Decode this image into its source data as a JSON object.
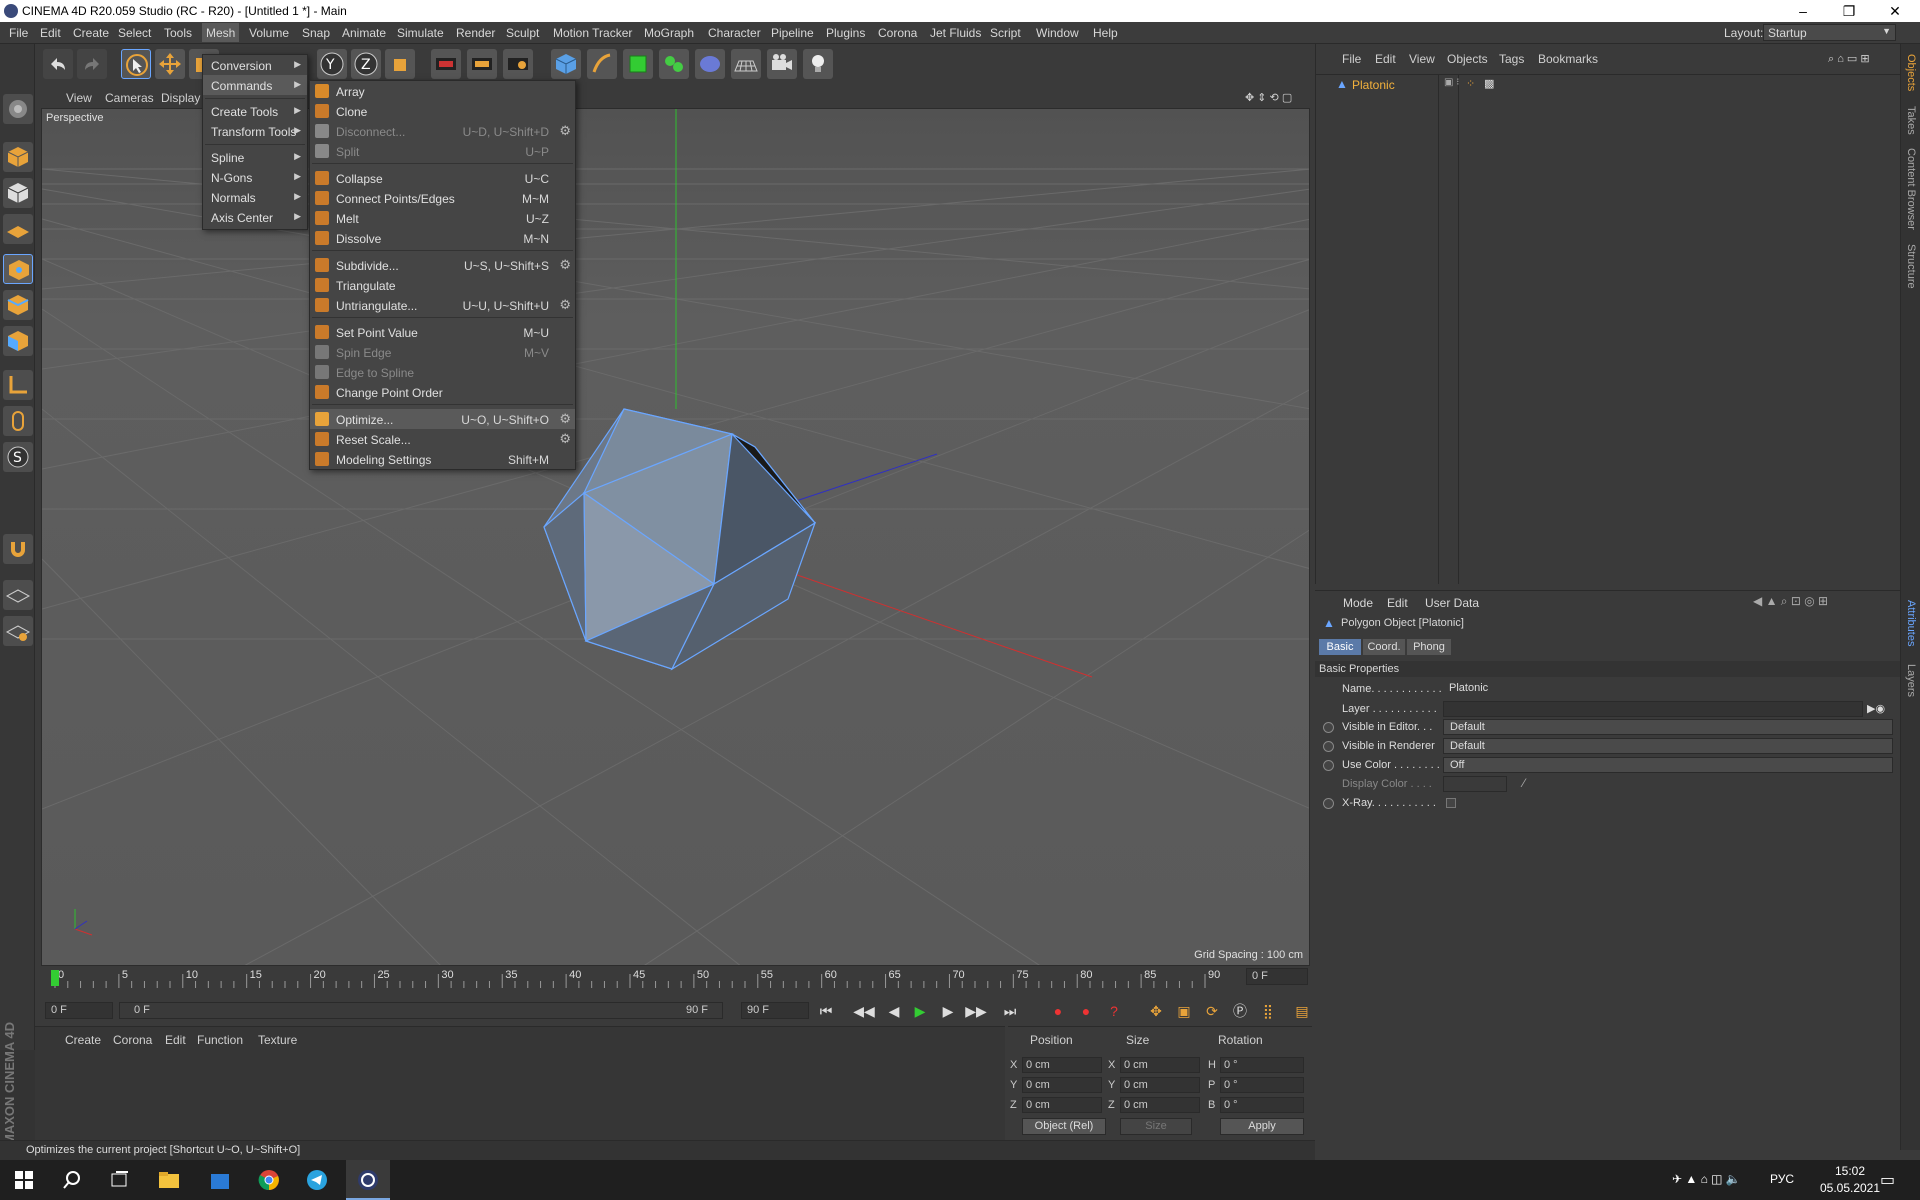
{
  "window": {
    "title": "CINEMA 4D R20.059 Studio (RC - R20) - [Untitled 1 *] - Main",
    "minimize": "–",
    "restore": "❐",
    "close": "✕"
  },
  "menubar": {
    "items": [
      "File",
      "Edit",
      "Create",
      "Select",
      "Tools",
      "Mesh",
      "Volume",
      "Snap",
      "Animate",
      "Simulate",
      "Render",
      "Sculpt",
      "Motion Tracker",
      "MoGraph",
      "Character",
      "Pipeline",
      "Plugins",
      "Corona",
      "Jet Fluids",
      "Script",
      "Window",
      "Help"
    ],
    "layout_label": "Layout:",
    "layout_value": "Startup"
  },
  "mesh_menu": {
    "items": [
      "Conversion",
      "Commands",
      "Create Tools",
      "Transform Tools",
      "Spline",
      "N-Gons",
      "Normals",
      "Axis Center"
    ]
  },
  "commands_menu": {
    "items": [
      {
        "label": "Array",
        "shortcut": "",
        "disabled": false,
        "gear": false
      },
      {
        "label": "Clone",
        "shortcut": "",
        "disabled": false,
        "gear": false
      },
      {
        "label": "Disconnect...",
        "shortcut": "U~D, U~Shift+D",
        "disabled": true,
        "gear": true
      },
      {
        "label": "Split",
        "shortcut": "U~P",
        "disabled": true,
        "gear": false
      },
      {
        "label": "Collapse",
        "shortcut": "U~C",
        "disabled": false,
        "gear": false
      },
      {
        "label": "Connect Points/Edges",
        "shortcut": "M~M",
        "disabled": false,
        "gear": false
      },
      {
        "label": "Melt",
        "shortcut": "U~Z",
        "disabled": false,
        "gear": false
      },
      {
        "label": "Dissolve",
        "shortcut": "M~N",
        "disabled": false,
        "gear": false
      },
      {
        "label": "Subdivide...",
        "shortcut": "U~S, U~Shift+S",
        "disabled": false,
        "gear": true
      },
      {
        "label": "Triangulate",
        "shortcut": "",
        "disabled": false,
        "gear": false
      },
      {
        "label": "Untriangulate...",
        "shortcut": "U~U, U~Shift+U",
        "disabled": false,
        "gear": true
      },
      {
        "label": "Set Point Value",
        "shortcut": "M~U",
        "disabled": false,
        "gear": false
      },
      {
        "label": "Spin Edge",
        "shortcut": "M~V",
        "disabled": true,
        "gear": false
      },
      {
        "label": "Edge to Spline",
        "shortcut": "",
        "disabled": true,
        "gear": false
      },
      {
        "label": "Change Point Order",
        "shortcut": "",
        "disabled": false,
        "gear": false
      },
      {
        "label": "Optimize...",
        "shortcut": "U~O, U~Shift+O",
        "disabled": false,
        "gear": true,
        "selected": true
      },
      {
        "label": "Reset Scale...",
        "shortcut": "",
        "disabled": false,
        "gear": true
      },
      {
        "label": "Modeling Settings",
        "shortcut": "Shift+M",
        "disabled": false,
        "gear": false
      }
    ]
  },
  "viewport": {
    "menu": [
      "View",
      "Cameras",
      "Display"
    ],
    "camera": "Perspective",
    "grid_spacing": "Grid Spacing : 100 cm"
  },
  "timeline": {
    "ticks": [
      "0",
      "5",
      "10",
      "15",
      "20",
      "25",
      "30",
      "35",
      "40",
      "45",
      "50",
      "55",
      "60",
      "65",
      "70",
      "75",
      "80",
      "85",
      "90"
    ],
    "current_frame": "0 F",
    "start": "0 F",
    "range_start": "0 F",
    "range_end": "90 F",
    "end": "90 F"
  },
  "material_manager": {
    "menu": [
      "Create",
      "Corona",
      "Edit",
      "Function",
      "Texture"
    ]
  },
  "coordinates": {
    "headers": [
      "Position",
      "Size",
      "Rotation"
    ],
    "rows": [
      {
        "axis": "X",
        "pos": "0 cm",
        "saxis": "X",
        "size": "0 cm",
        "raxis": "H",
        "rot": "0 °"
      },
      {
        "axis": "Y",
        "pos": "0 cm",
        "saxis": "Y",
        "size": "0 cm",
        "raxis": "P",
        "rot": "0 °"
      },
      {
        "axis": "Z",
        "pos": "0 cm",
        "saxis": "Z",
        "size": "0 cm",
        "raxis": "B",
        "rot": "0 °"
      }
    ],
    "mode": "Object (Rel)",
    "size_mode": "Size",
    "apply": "Apply"
  },
  "status": "Optimizes the current project [Shortcut U~O, U~Shift+O]",
  "object_manager": {
    "menu": [
      "File",
      "Edit",
      "View",
      "Objects",
      "Tags",
      "Bookmarks"
    ],
    "objects": [
      "Platonic"
    ]
  },
  "attributes": {
    "menu": [
      "Mode",
      "Edit",
      "User Data"
    ],
    "object_title": "Polygon Object [Platonic]",
    "tabs": [
      "Basic",
      "Coord.",
      "Phong"
    ],
    "section": "Basic Properties",
    "rows": [
      {
        "label": "Name. . . . . . . . . . . .",
        "value": "Platonic"
      },
      {
        "label": "Layer . . . . . . . . . . .",
        "value": ""
      },
      {
        "label": "Visible in Editor. . .",
        "value": "Default"
      },
      {
        "label": "Visible in Renderer",
        "value": "Default"
      },
      {
        "label": "Use Color . . . . . . . .",
        "value": "Off"
      },
      {
        "label": "Display Color . . . .",
        "value": ""
      },
      {
        "label": "X-Ray. . . . . . . . . . .",
        "value": ""
      }
    ]
  },
  "side_tabs": [
    "Objects",
    "Takes",
    "Content Browser",
    "Structure",
    "Attributes",
    "Layers"
  ],
  "branding": "MAXON CINEMA 4D",
  "taskbar": {
    "lang": "РУС",
    "time": "15:02",
    "date": "05.05.2021"
  },
  "colors": {
    "accent_orange": "#e8a33a",
    "select_blue": "#6aa6ff",
    "object_label": "#f3b13c",
    "axis_y": "#2fbf2f",
    "axis_x": "#d03030",
    "axis_z": "#3030c0"
  }
}
